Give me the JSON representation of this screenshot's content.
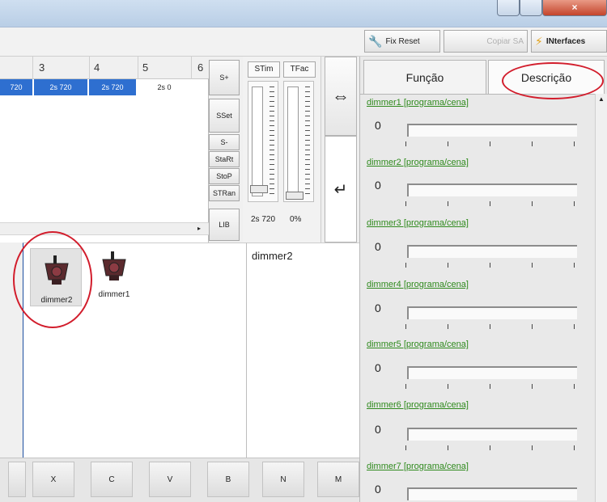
{
  "toolbar": {
    "fix_reset": "Fix Reset",
    "copiar_sa": "Copiar SA",
    "interfaces": "INterfaces"
  },
  "grid": {
    "columns": [
      "3",
      "4",
      "5",
      "6"
    ],
    "cells": [
      "720",
      "2s 720",
      "2s 720",
      "2s 0"
    ]
  },
  "side_buttons": [
    "S+",
    "SSet",
    "S-",
    "StaRt",
    "StoP",
    "STRan",
    "LIB"
  ],
  "sliders": {
    "stim_label": "STim",
    "tfac_label": "TFac",
    "stim_value": "2s 720",
    "tfac_value": "0%"
  },
  "arrows": {
    "swap": "⇔",
    "enter": "↵"
  },
  "devices": [
    {
      "name": "dimmer2",
      "selected": true
    },
    {
      "name": "dimmer1",
      "selected": false
    }
  ],
  "info": {
    "selected_device": "dimmer2"
  },
  "keyboard": {
    "keys": [
      "X",
      "C",
      "V",
      "B",
      "N",
      "M"
    ]
  },
  "tabs": {
    "funcao": "Função",
    "descricao": "Descrição"
  },
  "dimmer_list": [
    {
      "label": "dimmer1 [programa/cena]",
      "value": "0"
    },
    {
      "label": "dimmer2 [programa/cena]",
      "value": "0"
    },
    {
      "label": "dimmer3 [programa/cena]",
      "value": "0"
    },
    {
      "label": "dimmer4 [programa/cena]",
      "value": "0"
    },
    {
      "label": "dimmer5 [programa/cena]",
      "value": "0"
    },
    {
      "label": "dimmer6 [programa/cena]",
      "value": "0"
    },
    {
      "label": "dimmer7 [programa/cena]",
      "value": "0"
    }
  ],
  "colors": {
    "selection_blue": "#2e6fd0",
    "highlight_red": "#d21d2c",
    "link_green": "#2f8a1d"
  }
}
